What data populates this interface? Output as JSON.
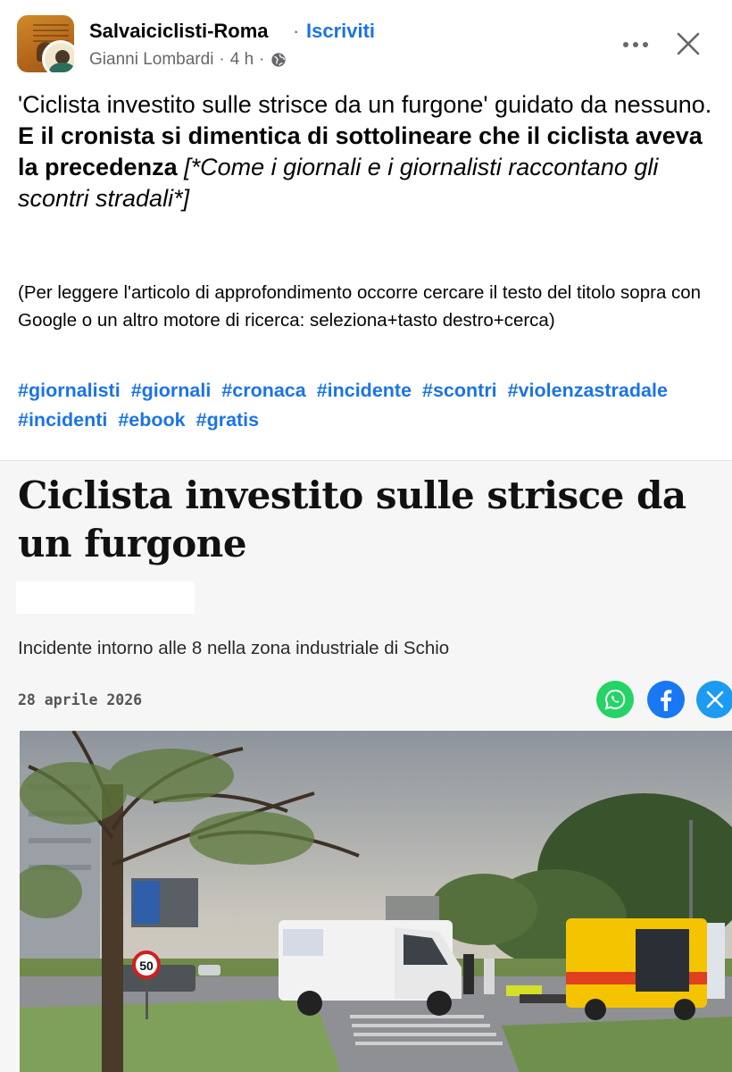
{
  "header": {
    "page_name": "Salvaiciclisti-Roma",
    "separator": "·",
    "follow_label": "Iscriviti",
    "author": "Gianni Lombardi",
    "time": "4 h",
    "time_separator": "·",
    "privacy_icon": "globe-icon",
    "more_icon": "more-horizontal-icon",
    "close_icon": "close-icon"
  },
  "post": {
    "text_plain": "'Ciclista investito sulle strisce da un furgone' guidato da nessuno.",
    "text_bold": "E il cronista si dimentica di sottolineare che il ciclista aveva la precedenza",
    "text_italic": "[*Come i giornali e i giornalisti raccontano gli scontri stradali*]",
    "note": "(Per leggere l'articolo di approfondimento occorre cercare il testo del titolo sopra con Google o un altro motore di ricerca: seleziona+tasto destro+cerca)",
    "hashtags": [
      "#giornalisti",
      "#giornali",
      "#cronaca",
      "#incidente",
      "#scontri",
      "#violenzastradale",
      "#incidenti",
      "#ebook",
      "#gratis"
    ]
  },
  "article": {
    "title": "Ciclista investito sulle strisce da un furgone",
    "subtitle": "Incidente intorno alle 8 nella zona industriale di Schio",
    "date": "28 aprile 2026",
    "share_icons": [
      "whatsapp-icon",
      "facebook-icon",
      "x-icon"
    ],
    "photo": {
      "speed_sign": "50"
    }
  },
  "colors": {
    "link_blue": "#1b74e4",
    "secondary_text": "#65676b",
    "whatsapp": "#25d366",
    "facebook": "#1877f2",
    "x": "#1d9bf0"
  }
}
